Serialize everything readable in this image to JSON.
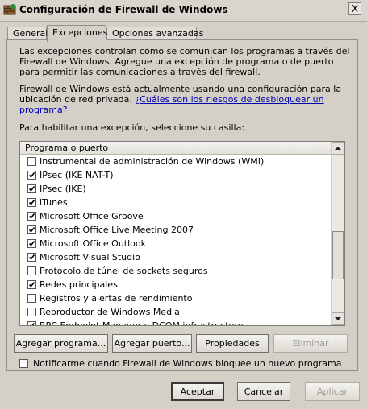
{
  "window": {
    "title": "Configuración de Firewall de Windows",
    "close_label": "X"
  },
  "tabs": [
    {
      "label": "General",
      "active": false
    },
    {
      "label": "Excepciones",
      "active": true
    },
    {
      "label": "Opciones avanzadas",
      "active": false
    }
  ],
  "description": "Las excepciones controlan cómo se comunican los programas a través del Firewall de Windows. Agregue una excepción de programa o de puerto para permitir las comunicaciones a través del firewall.",
  "location_text": "Firewall de Windows está actualmente usando una configuración para la ubicación de red privada.",
  "risk_link": "¿Cuáles son los riesgos de desbloquear un programa?",
  "enable_instruction": "Para habilitar una excepción, seleccione su casilla:",
  "list": {
    "header": "Programa o puerto",
    "items": [
      {
        "label": "Instrumental de administración de Windows (WMI)",
        "checked": false
      },
      {
        "label": "IPsec (IKE NAT-T)",
        "checked": true
      },
      {
        "label": "IPsec (IKE)",
        "checked": true
      },
      {
        "label": "iTunes",
        "checked": true
      },
      {
        "label": "Microsoft Office Groove",
        "checked": true
      },
      {
        "label": "Microsoft Office Live Meeting 2007",
        "checked": true
      },
      {
        "label": "Microsoft Office Outlook",
        "checked": true
      },
      {
        "label": "Microsoft Visual Studio",
        "checked": true
      },
      {
        "label": "Protocolo de túnel de sockets seguros",
        "checked": false
      },
      {
        "label": "Redes principales",
        "checked": true
      },
      {
        "label": "Registros y alertas de rendimiento",
        "checked": false
      },
      {
        "label": "Reproductor de Windows Media",
        "checked": false
      },
      {
        "label": "RPC Endpoint Manager y DCOM infrastructure",
        "checked": true
      }
    ]
  },
  "actions": {
    "add_program": "Agregar programa...",
    "add_port": "Agregar puerto...",
    "properties": "Propiedades",
    "remove": "Eliminar"
  },
  "notify": {
    "label": "Notificarme cuando Firewall de Windows bloquee un nuevo programa",
    "checked": false
  },
  "footer": {
    "accept": "Aceptar",
    "cancel": "Cancelar",
    "apply": "Aplicar"
  },
  "colors": {
    "dialog_bg": "#d4d0c8",
    "link": "#0000b0",
    "disabled_text": "#a09c94"
  }
}
